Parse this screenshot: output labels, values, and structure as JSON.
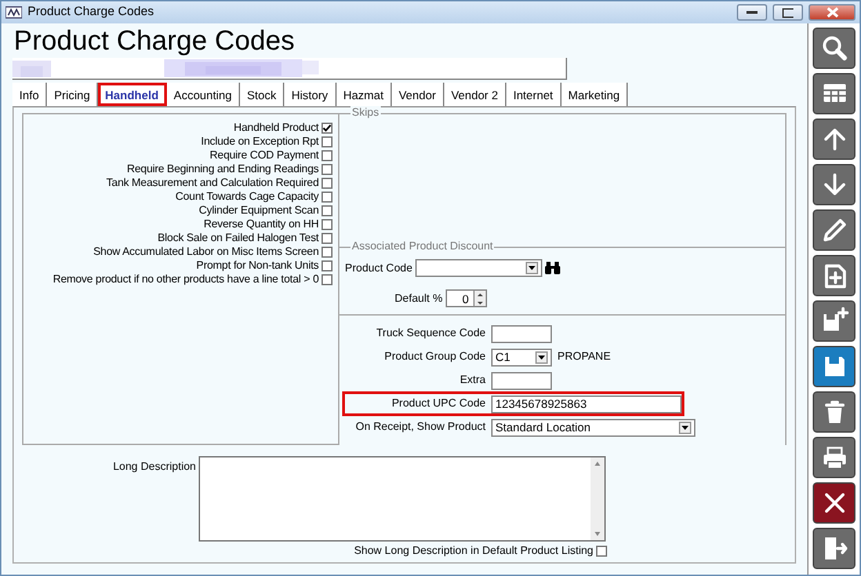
{
  "window": {
    "title": "Product Charge Codes"
  },
  "heading": "Product Charge Codes",
  "tabs": [
    {
      "label": "Info",
      "selected": false,
      "highlighted": false
    },
    {
      "label": "Pricing",
      "selected": false,
      "highlighted": false
    },
    {
      "label": "Handheld",
      "selected": true,
      "highlighted": true
    },
    {
      "label": "Accounting",
      "selected": false,
      "highlighted": false
    },
    {
      "label": "Stock",
      "selected": false,
      "highlighted": false
    },
    {
      "label": "History",
      "selected": false,
      "highlighted": false
    },
    {
      "label": "Hazmat",
      "selected": false,
      "highlighted": false
    },
    {
      "label": "Vendor",
      "selected": false,
      "highlighted": false
    },
    {
      "label": "Vendor 2",
      "selected": false,
      "highlighted": false
    },
    {
      "label": "Internet",
      "selected": false,
      "highlighted": false
    },
    {
      "label": "Marketing",
      "selected": false,
      "highlighted": false
    }
  ],
  "flags": [
    {
      "label": "Handheld Product",
      "checked": true
    },
    {
      "label": "Include on Exception Rpt",
      "checked": false
    },
    {
      "label": "Require COD Payment",
      "checked": false
    },
    {
      "label": "Require Beginning and Ending Readings",
      "checked": false
    },
    {
      "label": "Tank Measurement and Calculation Required",
      "checked": false
    },
    {
      "label": "Count Towards Cage Capacity",
      "checked": false
    },
    {
      "label": "Cylinder Equipment Scan",
      "checked": false
    },
    {
      "label": "Reverse Quantity on HH",
      "checked": false
    },
    {
      "label": "Block Sale on Failed Halogen Test",
      "checked": false
    },
    {
      "label": "Show Accumulated Labor on Misc Items Screen",
      "checked": false
    },
    {
      "label": "Prompt for Non-tank Units",
      "checked": false
    },
    {
      "label": "Remove product if no other products have a line total > 0",
      "checked": false
    }
  ],
  "skips": {
    "legend": "Skips"
  },
  "discount": {
    "legend": "Associated Product Discount",
    "product_code_label": "Product Code",
    "default_label": "Default %",
    "default_value": "0"
  },
  "fields": [
    {
      "kind": "text",
      "label": "Truck Sequence Code",
      "highlighted": false
    },
    {
      "kind": "select",
      "label": "Product Group Code",
      "value": "C1",
      "note": "PROPANE",
      "highlighted": false
    },
    {
      "kind": "text",
      "label": "Extra",
      "highlighted": false
    },
    {
      "kind": "wide-text",
      "label": "Product UPC Code",
      "value": "12345678925863",
      "highlighted": true
    },
    {
      "kind": "wide-select",
      "label": "On Receipt, Show Product",
      "value": "Standard Location",
      "highlighted": false
    }
  ],
  "long_description": {
    "label": "Long Description",
    "show_label": "Show Long Description in Default Product Listing",
    "show_checked": false
  },
  "toolbar": [
    {
      "color": "#6b6b6b"
    },
    {
      "color": "#6b6b6b"
    },
    {
      "color": "#6b6b6b"
    },
    {
      "color": "#6b6b6b"
    },
    {
      "color": "#6b6b6b"
    },
    {
      "color": "#6b6b6b"
    },
    {
      "color": "#6b6b6b"
    },
    {
      "color": "#1b7dbf"
    },
    {
      "color": "#6b6b6b"
    },
    {
      "color": "#6b6b6b"
    },
    {
      "color": "#8a1420"
    },
    {
      "color": "#6b6b6b"
    }
  ]
}
